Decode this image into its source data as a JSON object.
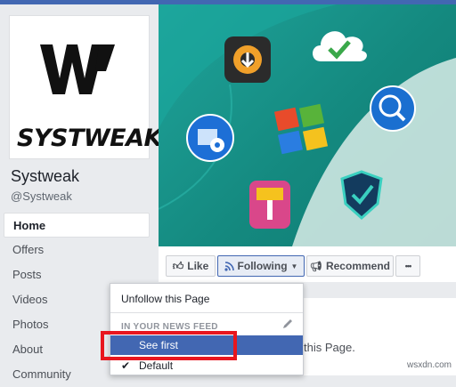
{
  "page": {
    "name": "Systweak",
    "handle": "@Systweak",
    "logo_text": "SYSTWEAK"
  },
  "nav": {
    "items": [
      {
        "label": "Home"
      },
      {
        "label": "Offers"
      },
      {
        "label": "Posts"
      },
      {
        "label": "Videos"
      },
      {
        "label": "Photos"
      },
      {
        "label": "About"
      },
      {
        "label": "Community"
      }
    ]
  },
  "actions": {
    "like": "Like",
    "following": "Following",
    "recommend": "Recommend",
    "more": "•••"
  },
  "dropdown": {
    "unfollow": "Unfollow this Page",
    "header": "IN YOUR NEWS FEED",
    "see_first": "See first",
    "default": "Default"
  },
  "behind": {
    "partial_text": "this Page."
  },
  "watermark": "wsxdn.com",
  "colors": {
    "facebook_blue": "#4267b2",
    "cover_teal": "#14897f",
    "highlight_red": "#e8161e"
  }
}
